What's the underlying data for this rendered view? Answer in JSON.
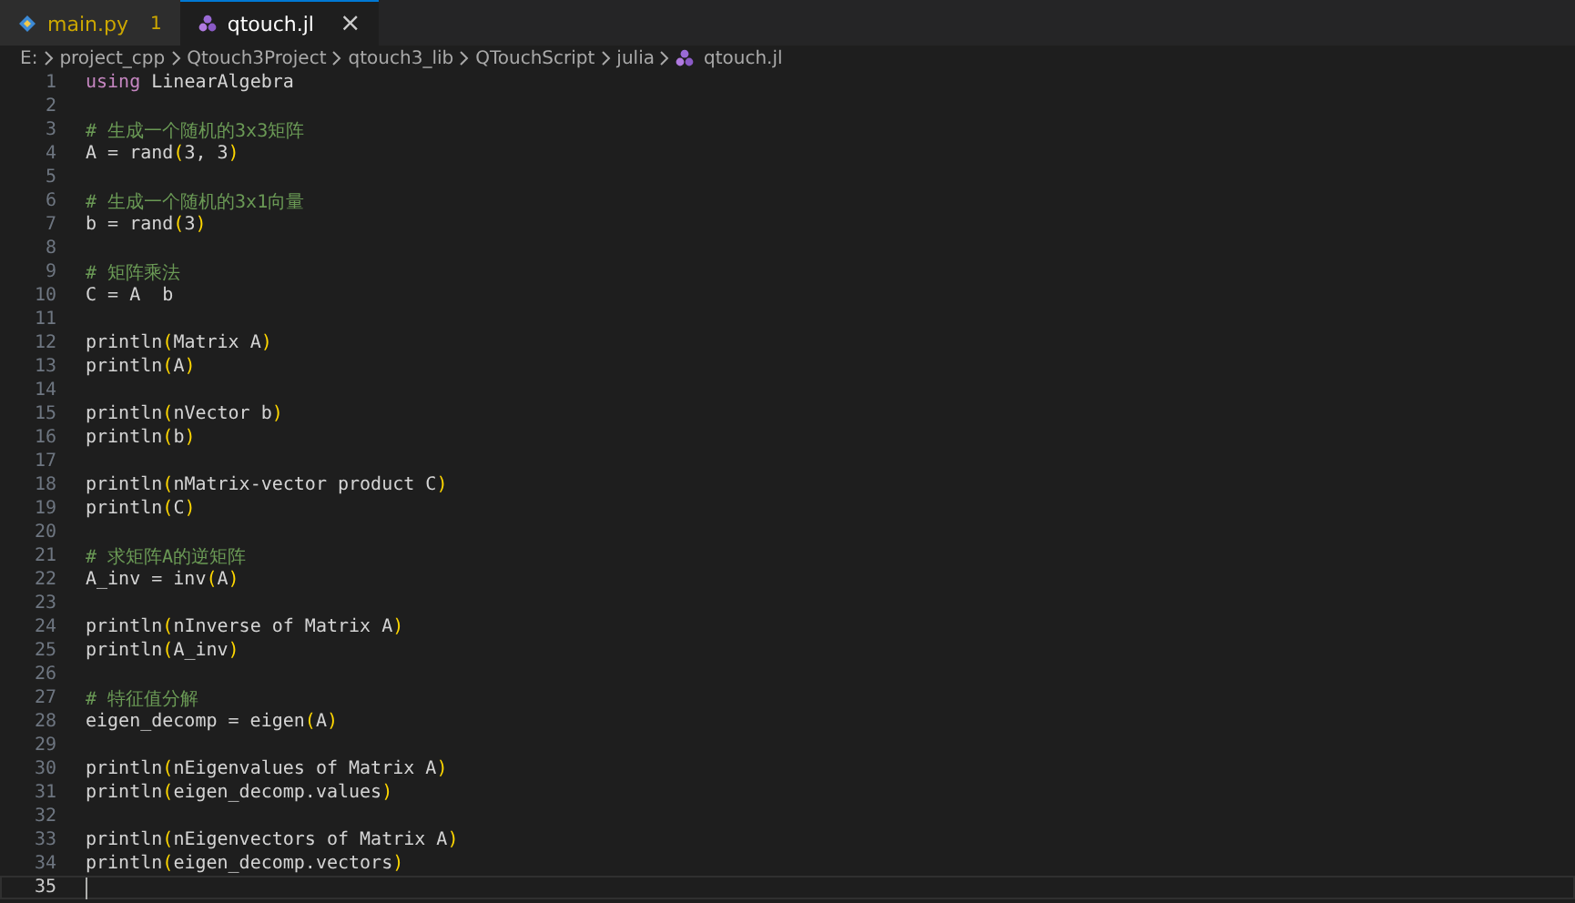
{
  "tabs": [
    {
      "label": "main.py",
      "kind": "python",
      "badge": "1",
      "selected": false,
      "modified_warning": true
    },
    {
      "label": "qtouch.jl",
      "kind": "julia",
      "selected": true,
      "close": "×"
    }
  ],
  "breadcrumbs": [
    {
      "label": "E:"
    },
    {
      "label": "project_cpp"
    },
    {
      "label": "Qtouch3Project"
    },
    {
      "label": "qtouch3_lib"
    },
    {
      "label": "QTouchScript"
    },
    {
      "label": "julia"
    },
    {
      "label": "qtouch.jl",
      "kind": "julia"
    }
  ],
  "lines": [
    {
      "number": "1",
      "current": false,
      "tokens": [
        {
          "text": "using",
          "kind": "keyword"
        },
        {
          "text": " LinearAlgebra",
          "kind": "plain"
        }
      ]
    },
    {
      "number": "2",
      "current": false
    },
    {
      "number": "3",
      "current": false,
      "tokens": [
        {
          "text": "# 生成一个随机的3x3矩阵",
          "kind": "comment"
        }
      ]
    },
    {
      "number": "4",
      "current": false,
      "tokens": [
        {
          "text": "A = rand",
          "kind": "plain"
        },
        {
          "text": "(",
          "kind": "bracket"
        },
        {
          "text": "3, 3",
          "kind": "plain"
        },
        {
          "text": ")",
          "kind": "bracket"
        }
      ]
    },
    {
      "number": "5",
      "current": false
    },
    {
      "number": "6",
      "current": false,
      "tokens": [
        {
          "text": "# 生成一个随机的3x1向量",
          "kind": "comment"
        }
      ]
    },
    {
      "number": "7",
      "current": false,
      "tokens": [
        {
          "text": "b = rand",
          "kind": "plain"
        },
        {
          "text": "(",
          "kind": "bracket"
        },
        {
          "text": "3",
          "kind": "plain"
        },
        {
          "text": ")",
          "kind": "bracket"
        }
      ]
    },
    {
      "number": "8",
      "current": false
    },
    {
      "number": "9",
      "current": false,
      "tokens": [
        {
          "text": "# 矩阵乘法",
          "kind": "comment"
        }
      ]
    },
    {
      "number": "10",
      "current": false,
      "tokens": [
        {
          "text": "C = A  b",
          "kind": "plain"
        }
      ]
    },
    {
      "number": "11",
      "current": false
    },
    {
      "number": "12",
      "current": false,
      "tokens": [
        {
          "text": "println",
          "kind": "plain"
        },
        {
          "text": "(",
          "kind": "bracket"
        },
        {
          "text": "Matrix A",
          "kind": "plain"
        },
        {
          "text": ")",
          "kind": "bracket"
        }
      ]
    },
    {
      "number": "13",
      "current": false,
      "tokens": [
        {
          "text": "println",
          "kind": "plain"
        },
        {
          "text": "(",
          "kind": "bracket"
        },
        {
          "text": "A",
          "kind": "plain"
        },
        {
          "text": ")",
          "kind": "bracket"
        }
      ]
    },
    {
      "number": "14",
      "current": false
    },
    {
      "number": "15",
      "current": false,
      "tokens": [
        {
          "text": "println",
          "kind": "plain"
        },
        {
          "text": "(",
          "kind": "bracket"
        },
        {
          "text": "nVector b",
          "kind": "plain"
        },
        {
          "text": ")",
          "kind": "bracket"
        }
      ]
    },
    {
      "number": "16",
      "current": false,
      "tokens": [
        {
          "text": "println",
          "kind": "plain"
        },
        {
          "text": "(",
          "kind": "bracket"
        },
        {
          "text": "b",
          "kind": "plain"
        },
        {
          "text": ")",
          "kind": "bracket"
        }
      ]
    },
    {
      "number": "17",
      "current": false
    },
    {
      "number": "18",
      "current": false,
      "tokens": [
        {
          "text": "println",
          "kind": "plain"
        },
        {
          "text": "(",
          "kind": "bracket"
        },
        {
          "text": "nMatrix-vector product C",
          "kind": "plain"
        },
        {
          "text": ")",
          "kind": "bracket"
        }
      ]
    },
    {
      "number": "19",
      "current": false,
      "tokens": [
        {
          "text": "println",
          "kind": "plain"
        },
        {
          "text": "(",
          "kind": "bracket"
        },
        {
          "text": "C",
          "kind": "plain"
        },
        {
          "text": ")",
          "kind": "bracket"
        }
      ]
    },
    {
      "number": "20",
      "current": false
    },
    {
      "number": "21",
      "current": false,
      "tokens": [
        {
          "text": "# 求矩阵A的逆矩阵",
          "kind": "comment"
        }
      ]
    },
    {
      "number": "22",
      "current": false,
      "tokens": [
        {
          "text": "A_inv = inv",
          "kind": "plain"
        },
        {
          "text": "(",
          "kind": "bracket"
        },
        {
          "text": "A",
          "kind": "plain"
        },
        {
          "text": ")",
          "kind": "bracket"
        }
      ]
    },
    {
      "number": "23",
      "current": false
    },
    {
      "number": "24",
      "current": false,
      "tokens": [
        {
          "text": "println",
          "kind": "plain"
        },
        {
          "text": "(",
          "kind": "bracket"
        },
        {
          "text": "nInverse of Matrix A",
          "kind": "plain"
        },
        {
          "text": ")",
          "kind": "bracket"
        }
      ]
    },
    {
      "number": "25",
      "current": false,
      "tokens": [
        {
          "text": "println",
          "kind": "plain"
        },
        {
          "text": "(",
          "kind": "bracket"
        },
        {
          "text": "A_inv",
          "kind": "plain"
        },
        {
          "text": ")",
          "kind": "bracket"
        }
      ]
    },
    {
      "number": "26",
      "current": false
    },
    {
      "number": "27",
      "current": false,
      "tokens": [
        {
          "text": "# 特征值分解",
          "kind": "comment"
        }
      ]
    },
    {
      "number": "28",
      "current": false,
      "tokens": [
        {
          "text": "eigen_decomp = eigen",
          "kind": "plain"
        },
        {
          "text": "(",
          "kind": "bracket"
        },
        {
          "text": "A",
          "kind": "plain"
        },
        {
          "text": ")",
          "kind": "bracket"
        }
      ]
    },
    {
      "number": "29",
      "current": false
    },
    {
      "number": "30",
      "current": false,
      "tokens": [
        {
          "text": "println",
          "kind": "plain"
        },
        {
          "text": "(",
          "kind": "bracket"
        },
        {
          "text": "nEigenvalues of Matrix A",
          "kind": "plain"
        },
        {
          "text": ")",
          "kind": "bracket"
        }
      ]
    },
    {
      "number": "31",
      "current": false,
      "tokens": [
        {
          "text": "println",
          "kind": "plain"
        },
        {
          "text": "(",
          "kind": "bracket"
        },
        {
          "text": "eigen_decomp.values",
          "kind": "plain"
        },
        {
          "text": ")",
          "kind": "bracket"
        }
      ]
    },
    {
      "number": "32",
      "current": false
    },
    {
      "number": "33",
      "current": false,
      "tokens": [
        {
          "text": "println",
          "kind": "plain"
        },
        {
          "text": "(",
          "kind": "bracket"
        },
        {
          "text": "nEigenvectors of Matrix A",
          "kind": "plain"
        },
        {
          "text": ")",
          "kind": "bracket"
        }
      ]
    },
    {
      "number": "34",
      "current": false,
      "tokens": [
        {
          "text": "println",
          "kind": "plain"
        },
        {
          "text": "(",
          "kind": "bracket"
        },
        {
          "text": "eigen_decomp.vectors",
          "kind": "plain"
        },
        {
          "text": ")",
          "kind": "bracket"
        }
      ]
    },
    {
      "number": "35",
      "current": true
    }
  ]
}
